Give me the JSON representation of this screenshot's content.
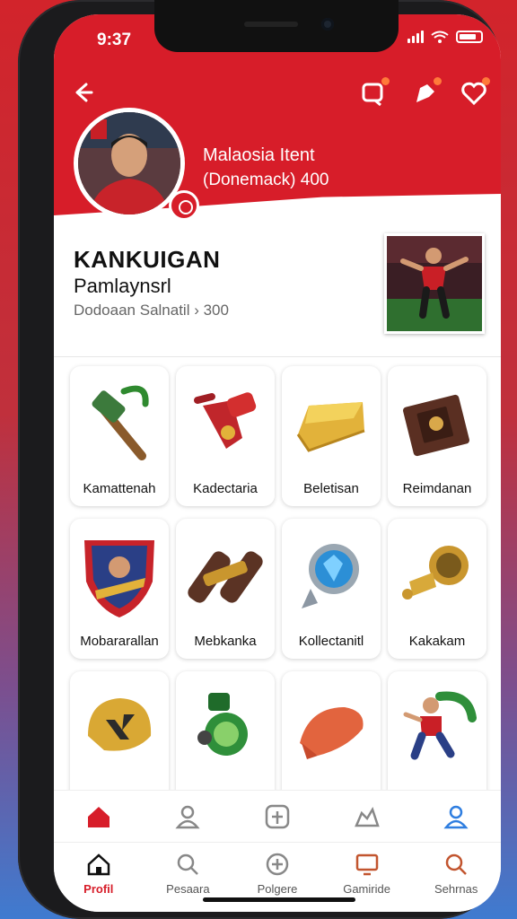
{
  "status": {
    "time": "9:37"
  },
  "header": {
    "name": "Malaosia Itent",
    "subtitle": "(Donemack)  400"
  },
  "profile": {
    "title": "KANKUIGAN",
    "subtitle": "Pamlaynsrl",
    "meta": "Dodoaan Salnatil  ›  300"
  },
  "items": [
    {
      "label": "Kamattenah"
    },
    {
      "label": "Kadectaria"
    },
    {
      "label": "Beletisan"
    },
    {
      "label": "Reimdanan"
    },
    {
      "label": "Mobararallan"
    },
    {
      "label": "Mebkanka"
    },
    {
      "label": "Kollectanitl"
    },
    {
      "label": "Kakakam"
    },
    {
      "label": ""
    },
    {
      "label": ""
    },
    {
      "label": ""
    },
    {
      "label": ""
    }
  ],
  "bottom_nav": [
    {
      "label": "Profil"
    },
    {
      "label": "Pesaara"
    },
    {
      "label": "Polgere"
    },
    {
      "label": "Gamiride"
    },
    {
      "label": "Sehrnas"
    }
  ],
  "colors": {
    "accent": "#d71d29"
  },
  "icons": [
    "back-icon",
    "notification-icon",
    "add-friend-icon",
    "heart-icon",
    "home-icon",
    "user-icon",
    "add-icon",
    "shop-icon",
    "search-icon"
  ]
}
